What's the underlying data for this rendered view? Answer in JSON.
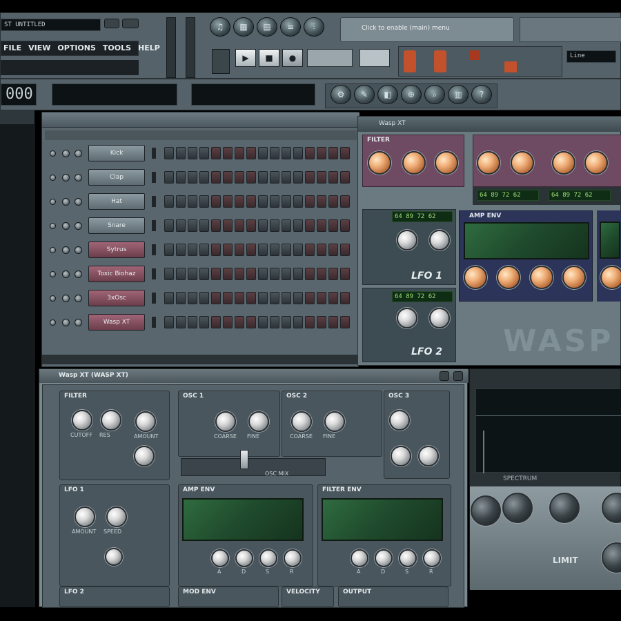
{
  "main_window": {
    "title": "ST UNTITLED",
    "menu": [
      "FILE",
      "VIEW",
      "OPTIONS",
      "TOOLS",
      "HELP"
    ],
    "hint_text": "Click to enable (main) menu",
    "time_display": "000",
    "pattern_name": "Line"
  },
  "step_sequencer": {
    "channels": [
      {
        "label": "Kick",
        "color": "gray"
      },
      {
        "label": "Clap",
        "color": "gray"
      },
      {
        "label": "Hat",
        "color": "gray"
      },
      {
        "label": "Snare",
        "color": "gray"
      },
      {
        "label": "Sytrus",
        "color": "pink"
      },
      {
        "label": "Toxic Biohaz",
        "color": "pink"
      },
      {
        "label": "3xOsc",
        "color": "pink"
      },
      {
        "label": "Wasp XT",
        "color": "pink"
      }
    ],
    "steps": 16
  },
  "right_synth": {
    "title": "Wasp XT",
    "filter_label": "FILTER",
    "lfo1_label": "LFO 1",
    "lfo2_label": "LFO 2",
    "amp_env_label": "AMP ENV",
    "readout": "64 89 72 62",
    "big_logo": "WASP"
  },
  "wasp_xt": {
    "title": "Wasp XT (WASP XT)",
    "sections": {
      "filter": "FILTER",
      "osc1": "OSC 1",
      "osc2": "OSC 2",
      "osc3": "OSC 3",
      "lfo1": "LFO 1",
      "amp_env": "AMP ENV",
      "filter_env": "FILTER ENV",
      "lfo2": "LFO 2",
      "mod_env": "MOD ENV",
      "velocity": "VELOCITY",
      "output": "OUTPUT"
    },
    "knob_labels": {
      "cutoff": "CUTOFF",
      "res": "RES",
      "env_amt": "AMOUNT",
      "coarse": "COARSE",
      "fine": "FINE",
      "amount": "AMOUNT",
      "speed": "SPEED",
      "a": "A",
      "d": "D",
      "s": "S",
      "r": "R"
    },
    "mix_label": "OSC MIX"
  },
  "analyzer": {
    "label": "SPECTRUM",
    "tag": "LIMIT"
  }
}
